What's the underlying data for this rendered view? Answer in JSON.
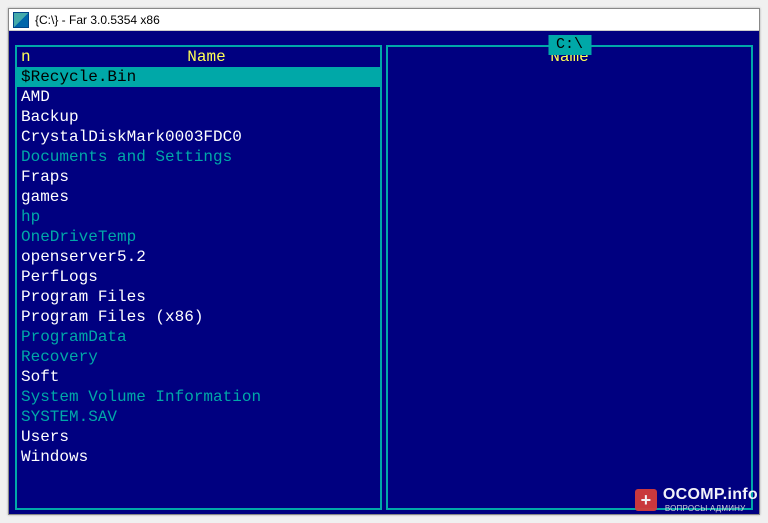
{
  "window": {
    "title": "{C:\\} - Far 3.0.5354 x86"
  },
  "path": "C:\\",
  "left_panel": {
    "sort_indicator": "n",
    "name_header": "Name",
    "items": [
      {
        "label": "$Recycle.Bin",
        "style": "selected"
      },
      {
        "label": "AMD",
        "style": "normal"
      },
      {
        "label": "Backup",
        "style": "normal"
      },
      {
        "label": "CrystalDiskMark0003FDC0",
        "style": "normal"
      },
      {
        "label": "Documents and Settings",
        "style": "system"
      },
      {
        "label": "Fraps",
        "style": "normal"
      },
      {
        "label": "games",
        "style": "normal"
      },
      {
        "label": "hp",
        "style": "system"
      },
      {
        "label": "OneDriveTemp",
        "style": "system"
      },
      {
        "label": "openserver5.2",
        "style": "normal"
      },
      {
        "label": "PerfLogs",
        "style": "normal"
      },
      {
        "label": "Program Files",
        "style": "normal"
      },
      {
        "label": "Program Files (x86)",
        "style": "normal"
      },
      {
        "label": "ProgramData",
        "style": "system"
      },
      {
        "label": "Recovery",
        "style": "system"
      },
      {
        "label": "Soft",
        "style": "normal"
      },
      {
        "label": "System Volume Information",
        "style": "system"
      },
      {
        "label": "SYSTEM.SAV",
        "style": "system"
      },
      {
        "label": "Users",
        "style": "normal"
      },
      {
        "label": "Windows",
        "style": "normal"
      }
    ]
  },
  "right_panel": {
    "name_header": "Name",
    "items": []
  },
  "watermark": {
    "plus": "+",
    "brand": "OCOMP.info",
    "sub": "ВОПРОСЫ АДМИНУ"
  }
}
